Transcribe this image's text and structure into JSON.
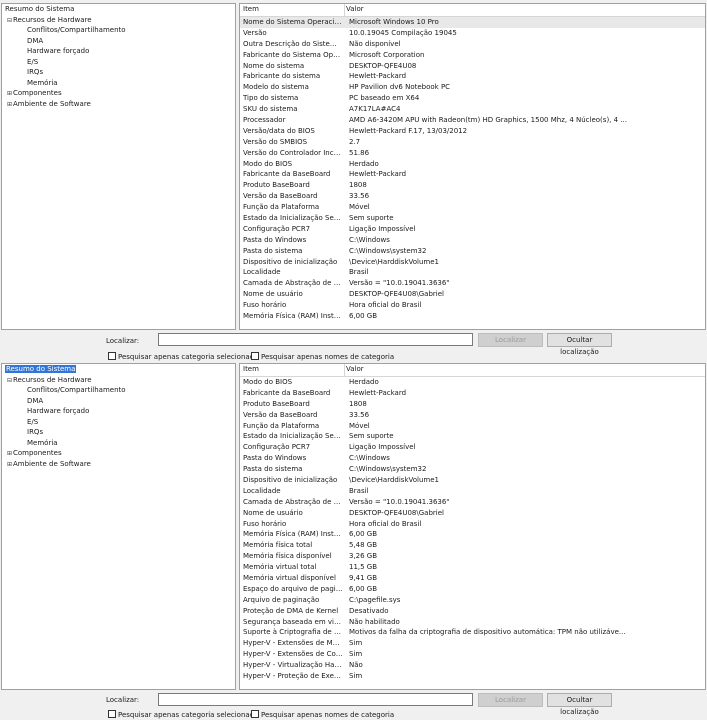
{
  "tree": {
    "root": "Resumo do Sistema",
    "hardware": "Recursos de Hardware",
    "hardware_items": [
      "Conflitos/Compartilhamento",
      "DMA",
      "Hardware forçado",
      "E/S",
      "IRQs",
      "Memória"
    ],
    "components": "Componentes",
    "software": "Ambiente de Software"
  },
  "columns": {
    "item": "Item",
    "value": "Valor"
  },
  "top_rows": [
    {
      "item": "Nome do Sistema Operacional",
      "value": "Microsoft Windows 10 Pro"
    },
    {
      "item": "Versão",
      "value": "10.0.19045 Compilação 19045"
    },
    {
      "item": "Outra Descrição do Sistema O...",
      "value": "Não disponível"
    },
    {
      "item": "Fabricante do Sistema Operaci...",
      "value": "Microsoft Corporation"
    },
    {
      "item": "Nome do sistema",
      "value": "DESKTOP-QFE4U08"
    },
    {
      "item": "Fabricante do sistema",
      "value": "Hewlett-Packard"
    },
    {
      "item": "Modelo do sistema",
      "value": "HP Pavilion dv6 Notebook PC"
    },
    {
      "item": "Tipo do sistema",
      "value": "PC baseado em X64"
    },
    {
      "item": "SKU do sistema",
      "value": "A7K17LA#AC4"
    },
    {
      "item": "Processador",
      "value": "AMD A6-3420M APU with Radeon(tm) HD Graphics, 1500 Mhz, 4 Núcleo(s), 4 ..."
    },
    {
      "item": "Versão/data do BIOS",
      "value": "Hewlett-Packard F.17, 13/03/2012"
    },
    {
      "item": "Versão do SMBIOS",
      "value": "2.7"
    },
    {
      "item": "Versão do Controlador Incorp...",
      "value": "51.86"
    },
    {
      "item": "Modo do BIOS",
      "value": "Herdado"
    },
    {
      "item": "Fabricante da BaseBoard",
      "value": "Hewlett-Packard"
    },
    {
      "item": "Produto BaseBoard",
      "value": "1808"
    },
    {
      "item": "Versão da BaseBoard",
      "value": "33.56"
    },
    {
      "item": "Função da Plataforma",
      "value": "Móvel"
    },
    {
      "item": "Estado da Inicialização Segura",
      "value": "Sem suporte"
    },
    {
      "item": "Configuração PCR7",
      "value": "Ligação Impossível"
    },
    {
      "item": "Pasta do Windows",
      "value": "C:\\Windows"
    },
    {
      "item": "Pasta do sistema",
      "value": "C:\\Windows\\system32"
    },
    {
      "item": "Dispositivo de inicialização",
      "value": "\\Device\\HarddiskVolume1"
    },
    {
      "item": "Localidade",
      "value": "Brasil"
    },
    {
      "item": "Camada de Abstração de Hard...",
      "value": "Versão = \"10.0.19041.3636\""
    },
    {
      "item": "Nome de usuário",
      "value": "DESKTOP-QFE4U08\\Gabriel"
    },
    {
      "item": "Fuso horário",
      "value": "Hora oficial do Brasil"
    },
    {
      "item": "Memória Física (RAM) Instalada",
      "value": "6,00 GB"
    }
  ],
  "bottom_rows": [
    {
      "item": "Modo do BIOS",
      "value": "Herdado"
    },
    {
      "item": "Fabricante da BaseBoard",
      "value": "Hewlett-Packard"
    },
    {
      "item": "Produto BaseBoard",
      "value": "1808"
    },
    {
      "item": "Versão da BaseBoard",
      "value": "33.56"
    },
    {
      "item": "Função da Plataforma",
      "value": "Móvel"
    },
    {
      "item": "Estado da Inicialização Segura",
      "value": "Sem suporte"
    },
    {
      "item": "Configuração PCR7",
      "value": "Ligação Impossível"
    },
    {
      "item": "Pasta do Windows",
      "value": "C:\\Windows"
    },
    {
      "item": "Pasta do sistema",
      "value": "C:\\Windows\\system32"
    },
    {
      "item": "Dispositivo de inicialização",
      "value": "\\Device\\HarddiskVolume1"
    },
    {
      "item": "Localidade",
      "value": "Brasil"
    },
    {
      "item": "Camada de Abstração de Hard...",
      "value": "Versão = \"10.0.19041.3636\""
    },
    {
      "item": "Nome de usuário",
      "value": "DESKTOP-QFE4U08\\Gabriel"
    },
    {
      "item": "Fuso horário",
      "value": "Hora oficial do Brasil"
    },
    {
      "item": "Memória Física (RAM) Instalada",
      "value": "6,00 GB"
    },
    {
      "item": "Memória física total",
      "value": "5,48 GB"
    },
    {
      "item": "Memória física disponível",
      "value": "3,26 GB"
    },
    {
      "item": "Memória virtual total",
      "value": "11,5 GB"
    },
    {
      "item": "Memória virtual disponível",
      "value": "9,41 GB"
    },
    {
      "item": "Espaço do arquivo de paginaç...",
      "value": "6,00 GB"
    },
    {
      "item": "Arquivo de paginação",
      "value": "C:\\pagefile.sys"
    },
    {
      "item": "Proteção de DMA de Kernel",
      "value": "Desativado"
    },
    {
      "item": "Segurança baseada em virtuali...",
      "value": "Não habilitado"
    },
    {
      "item": "Suporte à Criptografia de Disp...",
      "value": "Motivos da falha da criptografia de dispositivo automática: TPM não utilizáve..."
    },
    {
      "item": "Hyper-V - Extensões de Modo ...",
      "value": "Sim"
    },
    {
      "item": "Hyper-V - Extensões de Conver...",
      "value": "Sim"
    },
    {
      "item": "Hyper-V - Virtualização Habilita...",
      "value": "Não"
    },
    {
      "item": "Hyper-V - Proteção de Execuçã...",
      "value": "Sim"
    }
  ],
  "search": {
    "label": "Localizar:",
    "value": "",
    "find_button": "Localizar",
    "hide_button": "Ocultar localização",
    "opt_selected_category": "Pesquisar apenas categoria selecionada",
    "opt_category_names": "Pesquisar apenas nomes de categoria"
  }
}
